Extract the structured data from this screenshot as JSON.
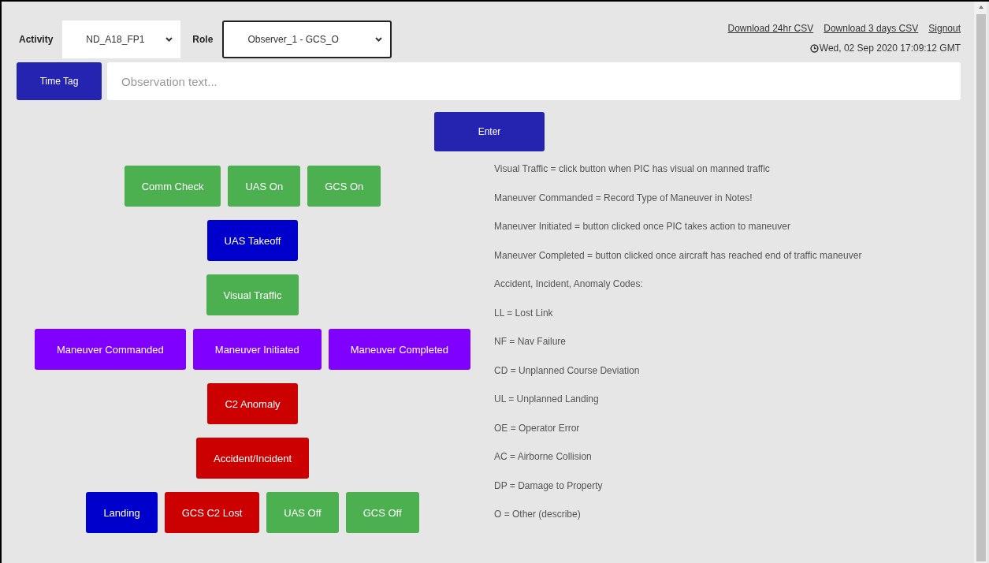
{
  "header": {
    "activity_label": "Activity",
    "activity_value": "ND_A18_FP1",
    "role_label": "Role",
    "role_value": "Observer_1 - GCS_O",
    "links": [
      "Download 24hr CSV",
      "Download 3 days CSV",
      "Signout"
    ],
    "datetime": "Wed, 02 Sep 2020 17:09:12 GMT"
  },
  "observation": {
    "time_tag_button": "Time Tag",
    "placeholder": "Observation text...",
    "enter_button": "Enter"
  },
  "button_rows": [
    {
      "buttons": [
        {
          "label": "Comm Check",
          "color": "#4caf50"
        },
        {
          "label": "UAS On",
          "color": "#4caf50"
        },
        {
          "label": "GCS On",
          "color": "#4caf50"
        }
      ]
    },
    {
      "buttons": [
        {
          "label": "UAS Takeoff",
          "color": "#0000cc"
        }
      ]
    },
    {
      "buttons": [
        {
          "label": "Visual Traffic",
          "color": "#4caf50"
        }
      ]
    },
    {
      "buttons": [
        {
          "label": "Maneuver Commanded",
          "color": "#7f00ff"
        },
        {
          "label": "Maneuver Initiated",
          "color": "#7f00ff"
        },
        {
          "label": "Maneuver Completed",
          "color": "#7f00ff"
        }
      ]
    },
    {
      "buttons": [
        {
          "label": "C2 Anomaly",
          "color": "#cc0000"
        }
      ]
    },
    {
      "buttons": [
        {
          "label": "Accident/Incident",
          "color": "#cc0000"
        }
      ]
    },
    {
      "buttons": [
        {
          "label": "Landing",
          "color": "#0000cc"
        },
        {
          "label": "GCS C2 Lost",
          "color": "#cc0000"
        },
        {
          "label": "UAS Off",
          "color": "#4caf50"
        },
        {
          "label": "GCS Off",
          "color": "#4caf50"
        }
      ]
    }
  ],
  "notes": [
    "Visual Traffic = click button when PIC has visual on manned traffic",
    "Maneuver Commanded = Record Type of Maneuver in Notes!",
    "Maneuver Initiated = button clicked once PIC takes action to maneuver",
    "Maneuver Completed = button clicked once aircraft has reached end of traffic maneuver",
    "Accident, Incident, Anomaly Codes:",
    "LL = Lost Link",
    "NF = Nav Failure",
    "CD = Unplanned Course Deviation",
    "UL = Unplanned Landing",
    "OE = Operator Error",
    "AC = Airborne Collision",
    "DP = Damage to Property",
    "O = Other (describe)"
  ]
}
